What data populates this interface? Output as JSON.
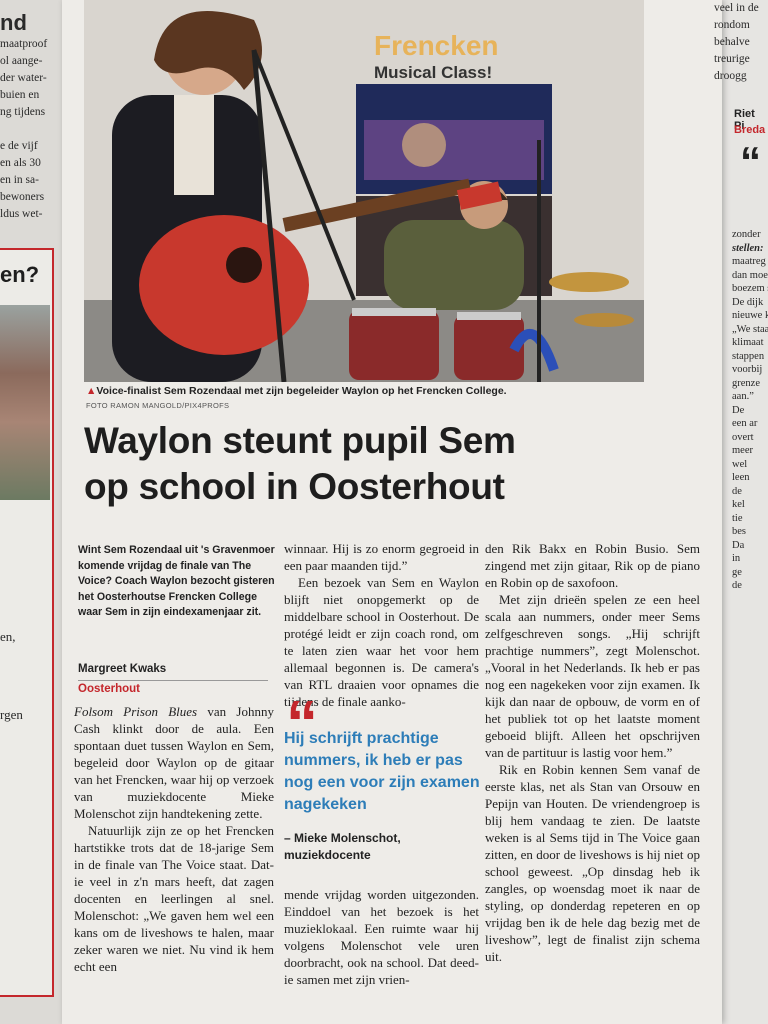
{
  "left_column": {
    "lines": [
      "nd",
      "maatproof",
      "ol aange-",
      "der water-",
      "buien en",
      "ng tijdens",
      "",
      "e de vijf",
      "en als 30",
      "en in sa-",
      "bewoners",
      "ldus wet-"
    ],
    "box_heading": "en?",
    "bottom_lines": [
      "en,",
      "rgen"
    ]
  },
  "right_column": {
    "top_lines": [
      "veel in de",
      "rondom",
      "behalve",
      "treurige",
      "droogg"
    ],
    "byline": "Riet Pi",
    "byplace": "Breda",
    "lines": [
      "zonder",
      "stellen:",
      "maatreg",
      "dan moe",
      "boezem s",
      "De dijk",
      "nieuwe k",
      "„We staa",
      "klimaat",
      "stappen",
      "voorbij",
      "grenze",
      "aan.”",
      "De",
      "een ar",
      "overt",
      "meer",
      "wel",
      "leen",
      "de",
      "kel",
      "tie",
      "bes",
      "Da",
      "in",
      "ge",
      "de"
    ]
  },
  "photo": {
    "banner_line1": "Frencken",
    "banner_line2": "Musical Class!"
  },
  "caption": {
    "text": "Voice-finalist Sem Rozendaal met zijn begeleider Waylon op het Frencken College.",
    "credit": "FOTO RAMON MANGOLD/PIX4PROFS"
  },
  "article": {
    "headline_line1": "Waylon steunt pupil Sem",
    "headline_line2": "op school in Oosterhout",
    "intro": "Wint Sem Rozendaal uit 's Gravenmoer komende vrijdag de finale van The Voice? Coach Waylon bezocht gisteren het Oosterhoutse Frencken College waar Sem in zijn eindexamenjaar zit.",
    "author": "Margreet Kwaks",
    "place": "Oosterhout",
    "col1_p1_title": "Folsom Prison Blues",
    "col1_p1": " van Johnny Cash klinkt door de aula. Een spontaan duet tussen Waylon en Sem, begeleid door Waylon op de gitaar van het Frencken, waar hij op verzoek van muziekdocente Mieke Molenschot zijn handtekening zette.",
    "col1_p2": "Natuurlijk zijn ze op het Frencken hartstikke trots dat de 18-jarige Sem in de finale van The Voice staat. Dat-ie veel in z'n mars heeft, dat zagen docenten en leerlingen al snel. Molenschot: „We gaven hem wel een kans om de liveshows te halen, maar zeker waren we niet. Nu vind ik hem echt een",
    "col2_p1": "winnaar. Hij is zo enorm gegroeid in een paar maanden tijd.”",
    "col2_p2": "Een bezoek van Sem en Waylon blijft niet onopgemerkt op de middelbare school in Oosterhout. De protégé leidt er zijn coach rond, om te laten zien waar het voor hem allemaal begonnen is. De camera's van RTL draaien voor opnames die tijdens de finale aanko-",
    "quote": "Hij schrijft prachtige nummers, ik heb er pas nog een voor zijn examen nagekeken",
    "quote_by": "– Mieke Molenschot, muziekdocente",
    "col2_p3": "mende vrijdag worden uitgezonden. Einddoel van het bezoek is het muzieklokaal. Een ruimte waar hij volgens Molenschot vele uren doorbracht, ook na school. Dat deed-ie samen met zijn vrien-",
    "col3_p1": "den Rik Bakx en Robin Busio. Sem zingend met zijn gitaar, Rik op de piano en Robin op de saxofoon.",
    "col3_p2": "Met zijn drieën spelen ze een heel scala aan nummers, onder meer Sems zelfgeschreven songs. „Hij schrijft prachtige nummers”, zegt Molenschot. „Vooral in het Nederlands. Ik heb er pas nog een nagekeken voor zijn examen. Ik kijk dan naar de opbouw, de vorm en of het publiek tot op het laatste moment geboeid blijft. Alleen het opschrijven van de partituur is lastig voor hem.”",
    "col3_p3": "Rik en Robin kennen Sem vanaf de eerste klas, net als Stan van Orsouw en Pepijn van Houten. De vriendengroep is blij hem vandaag te zien. De laatste weken is al Sems tijd in The Voice gaan zitten, en door de liveshows is hij niet op school geweest. „Op dinsdag heb ik zangles, op woensdag moet ik naar de styling, op donderdag repeteren en op vrijdag ben ik de hele dag bezig met de liveshow”, legt de finalist zijn schema uit."
  },
  "colors": {
    "accent_red": "#c4272c",
    "quote_blue": "#2d7db8"
  }
}
